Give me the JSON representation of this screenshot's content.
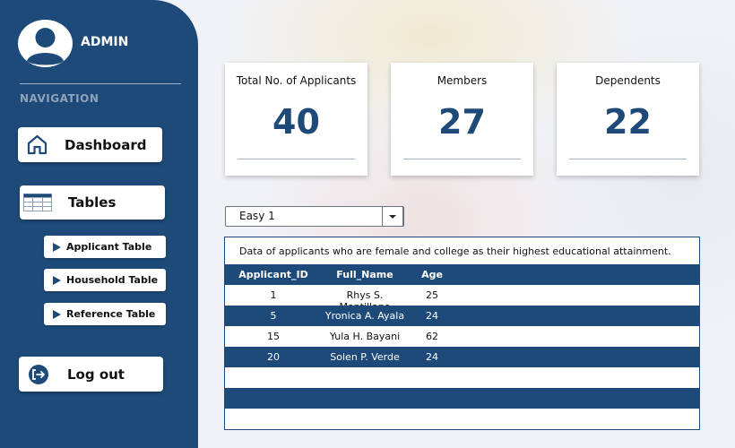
{
  "sidebar": {
    "user_name": "ADMIN",
    "nav_heading": "NAVIGATION",
    "dashboard_label": "Dashboard",
    "tables_label": "Tables",
    "sub_items": [
      {
        "label": "Applicant Table",
        "icon": "play-triangle-icon"
      },
      {
        "label": "Household Table",
        "icon": "play-triangle-icon"
      },
      {
        "label": "Reference Table",
        "icon": "play-triangle-icon"
      }
    ],
    "logout_label": "Log out",
    "icons": {
      "avatar": "user-avatar-icon",
      "dashboard": "home-icon",
      "tables": "table-icon",
      "logout": "logout-icon"
    }
  },
  "cards": [
    {
      "title": "Total No. of Applicants",
      "value": "40"
    },
    {
      "title": "Members",
      "value": "27"
    },
    {
      "title": "Dependents",
      "value": "22"
    }
  ],
  "filter": {
    "selected": "Easy 1"
  },
  "table": {
    "caption": "Data of applicants who are female and college as their highest educational attainment.",
    "columns": [
      "Applicant_ID",
      "Full_Name",
      "Age"
    ],
    "rows": [
      [
        "1",
        "Rhys S. Montillano",
        "25"
      ],
      [
        "5",
        "Yronica A. Ayala",
        "24"
      ],
      [
        "15",
        "Yula H. Bayani",
        "62"
      ],
      [
        "20",
        "Solen P. Verde",
        "24"
      ]
    ]
  },
  "colors": {
    "primary": "#1d4a78",
    "card_value": "#1d4a78",
    "background": "#f1f2f6"
  }
}
